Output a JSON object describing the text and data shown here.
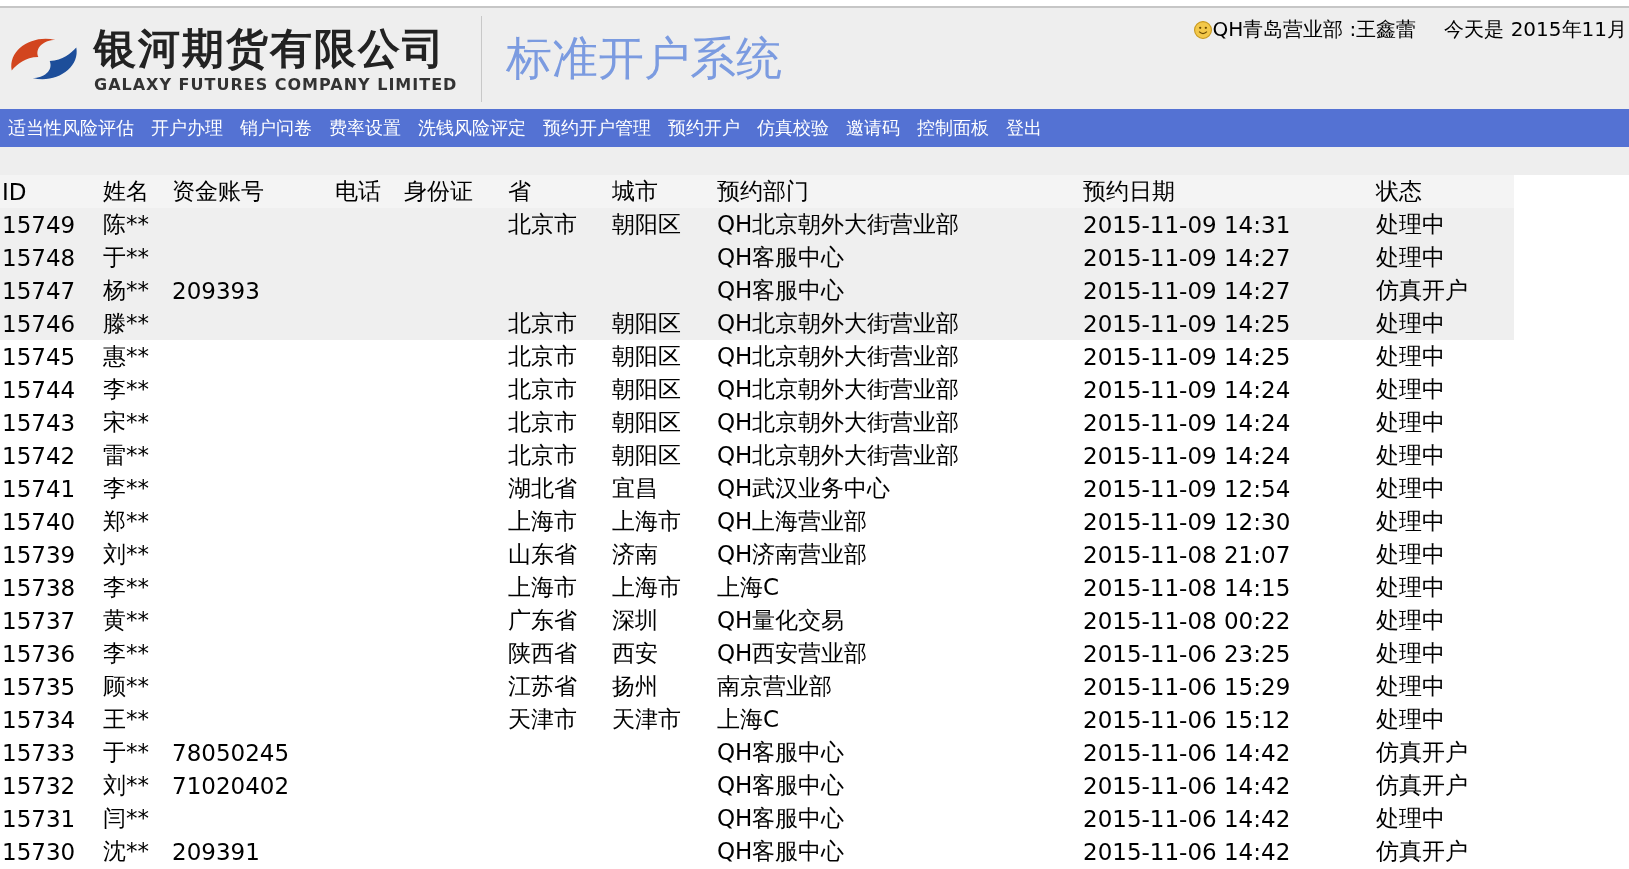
{
  "header": {
    "company_name": "银河期货有限公司",
    "company_name_en": "GALAXY FUTURES COMPANY LIMITED",
    "system_title": "标准开户系统",
    "user": "QH青岛营业部 :王鑫蕾",
    "date": "今天是 2015年11月"
  },
  "nav": [
    "适当性风险评估",
    "开户办理",
    "销户问卷",
    "费率设置",
    "洗钱风险评定",
    "预约开户管理",
    "预约开户",
    "仿真校验",
    "邀请码",
    "控制面板",
    "登出"
  ],
  "table": {
    "columns": [
      "ID",
      "姓名",
      "资金账号",
      "电话",
      "身份证",
      "省",
      "城市",
      "预约部门",
      "预约日期",
      "状态"
    ],
    "rows": [
      {
        "highlighted": true,
        "id": "15749",
        "name": "陈**",
        "province": "北京市",
        "city": "朝阳区",
        "dept": "QH北京朝外大街营业部",
        "date": "2015-11-09 14:31",
        "status": "处理中"
      },
      {
        "highlighted": true,
        "id": "15748",
        "name": "于**",
        "dept": "QH客服中心",
        "date": "2015-11-09 14:27",
        "status": "处理中"
      },
      {
        "highlighted": true,
        "id": "15747",
        "name": "杨**",
        "account": "209393",
        "dept": "QH客服中心",
        "date": "2015-11-09 14:27",
        "status": "仿真开户"
      },
      {
        "highlighted": true,
        "id": "15746",
        "name": "滕**",
        "province": "北京市",
        "city": "朝阳区",
        "dept": "QH北京朝外大街营业部",
        "date": "2015-11-09 14:25",
        "status": "处理中"
      },
      {
        "highlighted": false,
        "id": "15745",
        "name": "惠**",
        "province": "北京市",
        "city": "朝阳区",
        "dept": "QH北京朝外大街营业部",
        "date": "2015-11-09 14:25",
        "status": "处理中"
      },
      {
        "highlighted": false,
        "id": "15744",
        "name": "李**",
        "province": "北京市",
        "city": "朝阳区",
        "dept": "QH北京朝外大街营业部",
        "date": "2015-11-09 14:24",
        "status": "处理中"
      },
      {
        "highlighted": false,
        "id": "15743",
        "name": "宋**",
        "province": "北京市",
        "city": "朝阳区",
        "dept": "QH北京朝外大街营业部",
        "date": "2015-11-09 14:24",
        "status": "处理中"
      },
      {
        "highlighted": false,
        "id": "15742",
        "name": "雷**",
        "province": "北京市",
        "city": "朝阳区",
        "dept": "QH北京朝外大街营业部",
        "date": "2015-11-09 14:24",
        "status": "处理中"
      },
      {
        "highlighted": false,
        "id": "15741",
        "name": "李**",
        "province": "湖北省",
        "city": "宜昌",
        "dept": "QH武汉业务中心",
        "date": "2015-11-09 12:54",
        "status": "处理中"
      },
      {
        "highlighted": false,
        "id": "15740",
        "name": "郑**",
        "province": "上海市",
        "city": "上海市",
        "dept": "QH上海营业部",
        "date": "2015-11-09 12:30",
        "status": "处理中"
      },
      {
        "highlighted": false,
        "id": "15739",
        "name": "刘**",
        "province": "山东省",
        "city": "济南",
        "dept": "QH济南营业部",
        "date": "2015-11-08 21:07",
        "status": "处理中"
      },
      {
        "highlighted": false,
        "id": "15738",
        "name": "李**",
        "province": "上海市",
        "city": "上海市",
        "dept": "上海C",
        "date": "2015-11-08 14:15",
        "status": "处理中"
      },
      {
        "highlighted": false,
        "id": "15737",
        "name": "黄**",
        "province": "广东省",
        "city": "深圳",
        "dept": "QH量化交易",
        "date": "2015-11-08 00:22",
        "status": "处理中"
      },
      {
        "highlighted": false,
        "id": "15736",
        "name": "李**",
        "province": "陕西省",
        "city": "西安",
        "dept": "QH西安营业部",
        "date": "2015-11-06 23:25",
        "status": "处理中"
      },
      {
        "highlighted": false,
        "id": "15735",
        "name": "顾**",
        "province": "江苏省",
        "city": "扬州",
        "dept": "南京营业部",
        "date": "2015-11-06 15:29",
        "status": "处理中"
      },
      {
        "highlighted": false,
        "id": "15734",
        "name": "王**",
        "province": "天津市",
        "city": "天津市",
        "dept": "上海C",
        "date": "2015-11-06 15:12",
        "status": "处理中"
      },
      {
        "highlighted": false,
        "id": "15733",
        "name": "于**",
        "account": "78050245",
        "dept": "QH客服中心",
        "date": "2015-11-06 14:42",
        "status": "仿真开户"
      },
      {
        "highlighted": false,
        "id": "15732",
        "name": "刘**",
        "account": "71020402",
        "dept": "QH客服中心",
        "date": "2015-11-06 14:42",
        "status": "仿真开户"
      },
      {
        "highlighted": false,
        "id": "15731",
        "name": "闫**",
        "dept": "QH客服中心",
        "date": "2015-11-06 14:42",
        "status": "处理中"
      },
      {
        "highlighted": false,
        "id": "15730",
        "name": "沈**",
        "account": "209391",
        "dept": "QH客服中心",
        "date": "2015-11-06 14:42",
        "status": "仿真开户"
      }
    ]
  }
}
